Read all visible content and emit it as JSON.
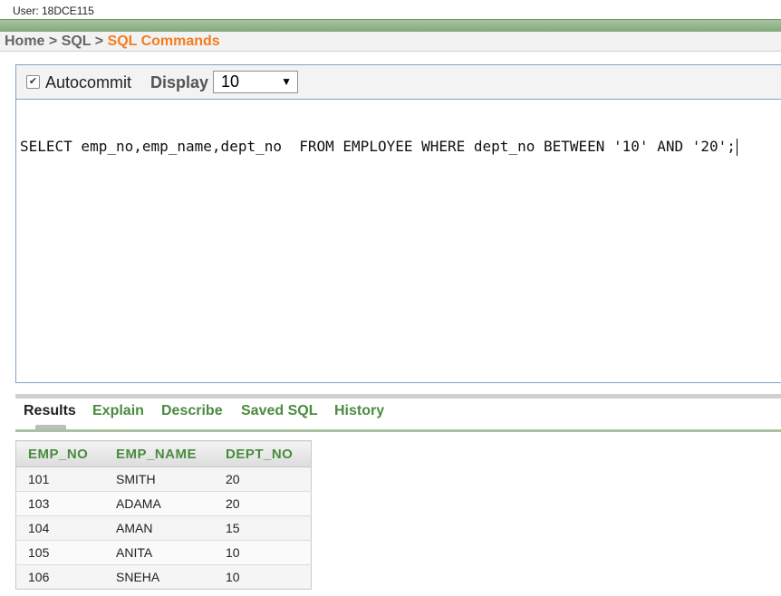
{
  "header": {
    "user_line": "User: 18DCE115"
  },
  "breadcrumb": {
    "home": "Home",
    "sep1": " > ",
    "sql": "SQL",
    "sep2": " > ",
    "current": "SQL Commands"
  },
  "toolbar": {
    "autocommit_label": "Autocommit",
    "autocommit_checked": true,
    "display_label": "Display",
    "display_value": "10"
  },
  "editor": {
    "sql": "SELECT emp_no,emp_name,dept_no  FROM EMPLOYEE WHERE dept_no BETWEEN '10' AND '20';"
  },
  "tabs": [
    {
      "label": "Results",
      "active": true
    },
    {
      "label": "Explain"
    },
    {
      "label": "Describe"
    },
    {
      "label": "Saved SQL"
    },
    {
      "label": "History"
    }
  ],
  "results": {
    "columns": [
      "EMP_NO",
      "EMP_NAME",
      "DEPT_NO"
    ],
    "rows": [
      [
        "101",
        "SMITH",
        "20"
      ],
      [
        "103",
        "ADAMA",
        "20"
      ],
      [
        "104",
        "AMAN",
        "15"
      ],
      [
        "105",
        "ANITA",
        "10"
      ],
      [
        "106",
        "SNEHA",
        "10"
      ]
    ]
  },
  "colors": {
    "accent_orange": "#f47c20",
    "tab_green": "#4a8b3f",
    "panel_border": "#7da2cf"
  }
}
